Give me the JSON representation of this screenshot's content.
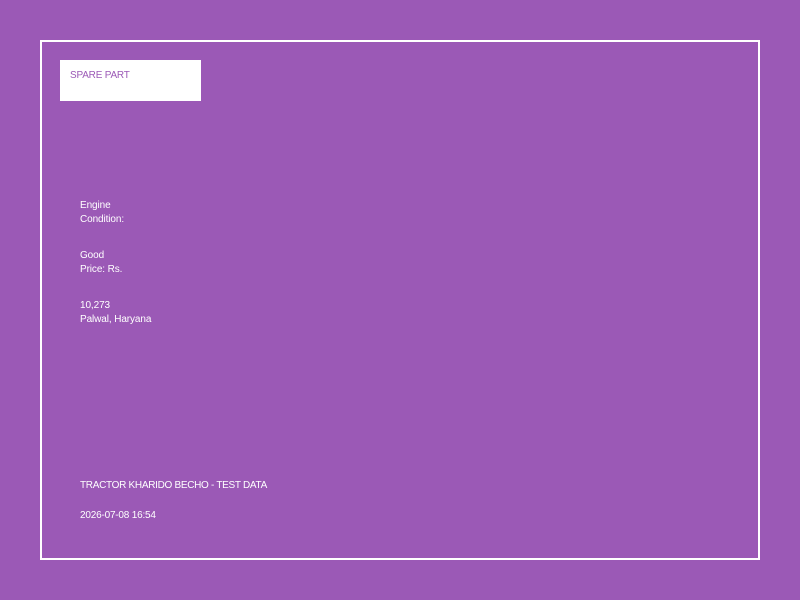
{
  "colors": {
    "background": "#9b59b6",
    "border": "#ffffff",
    "text": "#ffffff",
    "badge_background": "#ffffff",
    "badge_text": "#9b59b6"
  },
  "badge": {
    "label": "SPARE PART"
  },
  "details": {
    "line_1": "Engine\nCondition:",
    "line_2": "Good\nPrice: Rs.",
    "line_3": "10,273\nPalwal, Haryana"
  },
  "footer": {
    "title": "TRACTOR KHARIDO BECHO - TEST DATA",
    "timestamp": "2026-07-08 16:54"
  }
}
